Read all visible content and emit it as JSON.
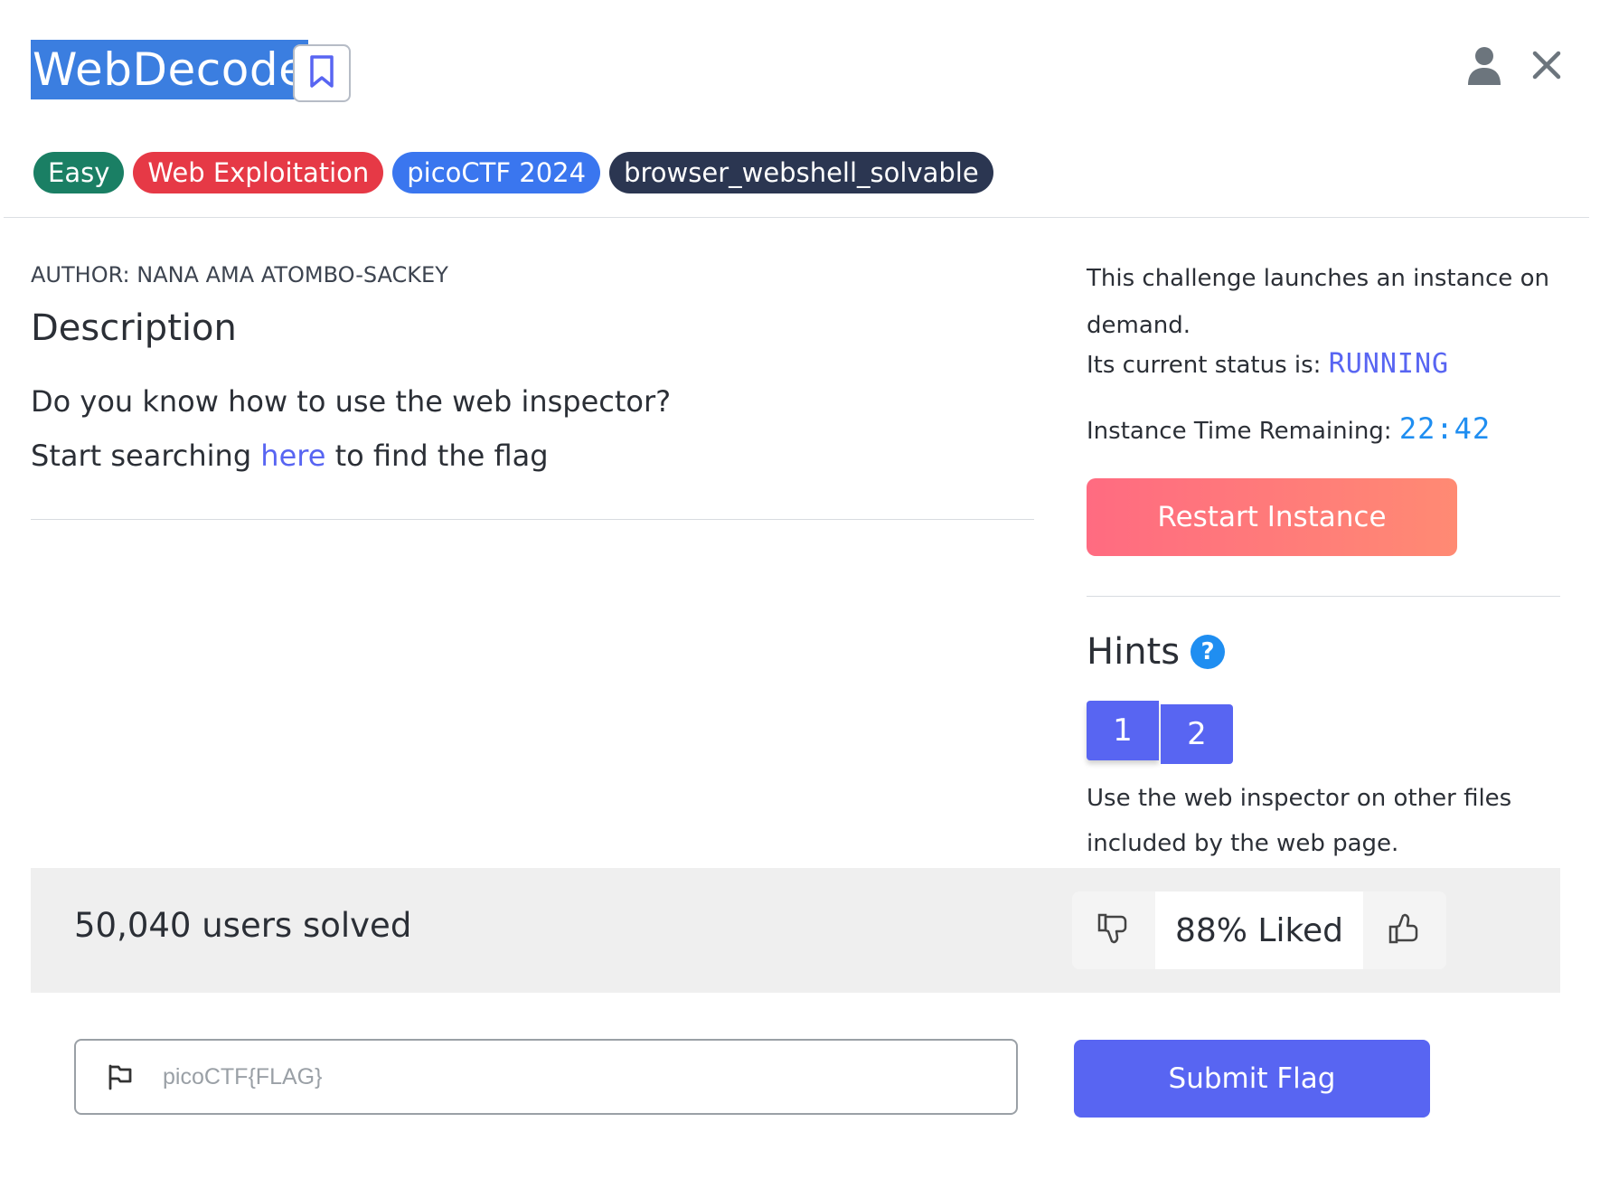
{
  "challenge": {
    "title": "WebDecode",
    "tags": [
      {
        "label": "Easy",
        "color": "#1a7f64"
      },
      {
        "label": "Web Exploitation",
        "color": "#e63946"
      },
      {
        "label": "picoCTF 2024",
        "color": "#3a76ef"
      },
      {
        "label": "browser_webshell_solvable",
        "color": "#2b3651"
      }
    ],
    "author": "AUTHOR: NANA AMA ATOMBO-SACKEY",
    "description_heading": "Description",
    "description_line1": "Do you know how to use the web inspector?",
    "description_line2_prefix": "Start searching ",
    "description_link": "here",
    "description_line2_suffix": " to find the flag"
  },
  "header": {
    "icons": [
      "bookmark-icon",
      "user-icon",
      "close-icon"
    ]
  },
  "instance": {
    "launch_text": "This challenge launches an instance on demand.",
    "status_label": "Its current status is: ",
    "status_value": "RUNNING",
    "time_label": "Instance Time Remaining: ",
    "time_value": "22:42",
    "restart_label": "Restart Instance",
    "accent_color": "#5865f2"
  },
  "hints": {
    "heading": "Hints",
    "tabs": [
      "1",
      "2"
    ],
    "active_tab": "1",
    "text": "Use the web inspector on other files included by the web page."
  },
  "stats": {
    "solved": "50,040 users solved",
    "liked": "88% Liked"
  },
  "flag": {
    "placeholder": "picoCTF{FLAG}",
    "value": "",
    "submit_label": "Submit Flag"
  }
}
